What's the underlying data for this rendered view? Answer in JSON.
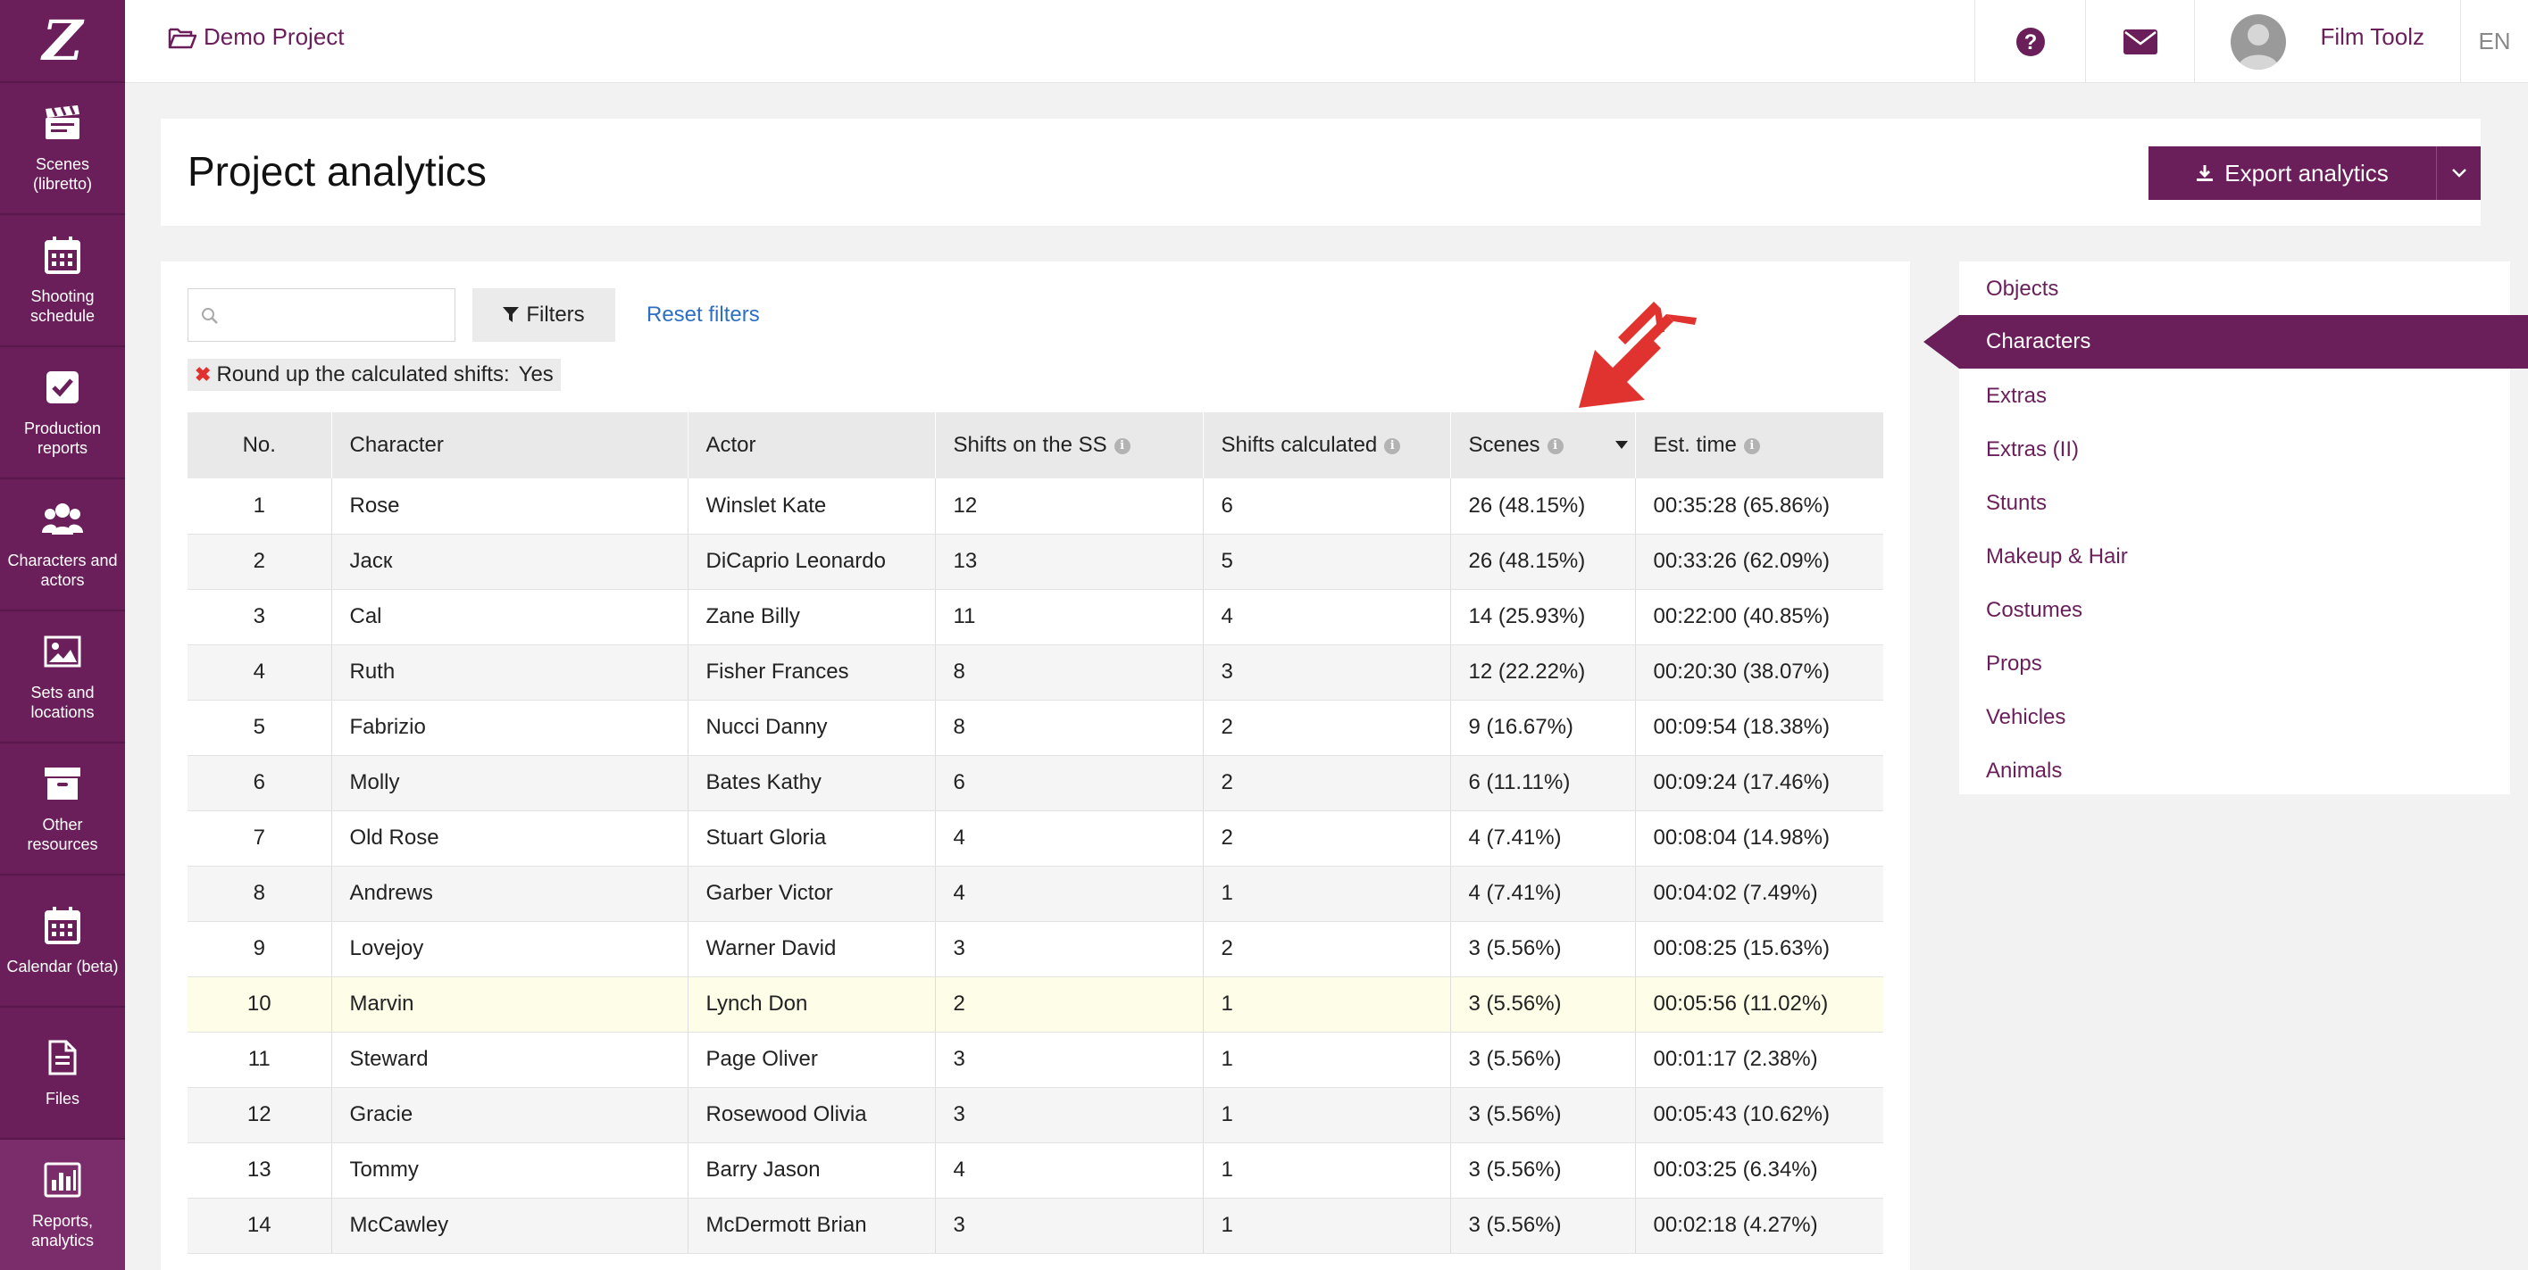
{
  "sidebar": {
    "logo": "Z",
    "items": [
      {
        "label": "Scenes (libretto)",
        "icon": "clapperboard-icon"
      },
      {
        "label": "Shooting schedule",
        "icon": "calendar-icon"
      },
      {
        "label": "Production reports",
        "icon": "checkbox-icon"
      },
      {
        "label": "Characters and actors",
        "icon": "users-icon"
      },
      {
        "label": "Sets and locations",
        "icon": "image-icon"
      },
      {
        "label": "Other resources",
        "icon": "archive-icon"
      },
      {
        "label": "Calendar (beta)",
        "icon": "calendar-icon"
      },
      {
        "label": "Files",
        "icon": "file-icon"
      },
      {
        "label": "Reports, analytics",
        "icon": "bar-chart-icon"
      }
    ]
  },
  "topbar": {
    "project": "Demo Project",
    "user": "Film Toolz",
    "lang": "EN"
  },
  "header": {
    "title": "Project analytics",
    "export": "Export analytics"
  },
  "filters": {
    "search_placeholder": "",
    "filters_label": "Filters",
    "reset_label": "Reset filters",
    "chip_label": "Round up the calculated shifts:",
    "chip_value": "Yes"
  },
  "table": {
    "columns": [
      "No.",
      "Character",
      "Actor",
      "Shifts on the SS",
      "Shifts calculated",
      "Scenes",
      "Est. time"
    ],
    "rows": [
      [
        "1",
        "Rose",
        "Winslet Kate",
        "12",
        "6",
        "26 (48.15%)",
        "00:35:28 (65.86%)"
      ],
      [
        "2",
        "Jacк",
        "DiCaprio Leonardo",
        "13",
        "5",
        "26 (48.15%)",
        "00:33:26 (62.09%)"
      ],
      [
        "3",
        "Cal",
        "Zane Billy",
        "11",
        "4",
        "14 (25.93%)",
        "00:22:00 (40.85%)"
      ],
      [
        "4",
        "Ruth",
        "Fisher Frances",
        "8",
        "3",
        "12 (22.22%)",
        "00:20:30 (38.07%)"
      ],
      [
        "5",
        "Fabrizio",
        "Nucci Danny",
        "8",
        "2",
        "9 (16.67%)",
        "00:09:54 (18.38%)"
      ],
      [
        "6",
        "Molly",
        "Bates Kathy",
        "6",
        "2",
        "6 (11.11%)",
        "00:09:24 (17.46%)"
      ],
      [
        "7",
        "Old Rose",
        "Stuart Gloria",
        "4",
        "2",
        "4 (7.41%)",
        "00:08:04 (14.98%)"
      ],
      [
        "8",
        "Andrews",
        "Garber Victor",
        "4",
        "1",
        "4 (7.41%)",
        "00:04:02 (7.49%)"
      ],
      [
        "9",
        "Lovejoy",
        "Warner David",
        "3",
        "2",
        "3 (5.56%)",
        "00:08:25 (15.63%)"
      ],
      [
        "10",
        "Marvin",
        "Lynch Don",
        "2",
        "1",
        "3 (5.56%)",
        "00:05:56 (11.02%)"
      ],
      [
        "11",
        "Steward",
        "Page Oliver",
        "3",
        "1",
        "3 (5.56%)",
        "00:01:17 (2.38%)"
      ],
      [
        "12",
        "Gracie",
        "Rosewood Olivia",
        "3",
        "1",
        "3 (5.56%)",
        "00:05:43 (10.62%)"
      ],
      [
        "13",
        "Tommy",
        "Barry Jason",
        "4",
        "1",
        "3 (5.56%)",
        "00:03:25 (6.34%)"
      ],
      [
        "14",
        "McCawley",
        "McDermott Brian",
        "3",
        "1",
        "3 (5.56%)",
        "00:02:18 (4.27%)"
      ]
    ]
  },
  "resources": {
    "items": [
      "Objects",
      "Characters",
      "Extras",
      "Extras (II)",
      "Stunts",
      "Makeup & Hair",
      "Costumes",
      "Props",
      "Vehicles",
      "Animals"
    ],
    "active": "Characters"
  },
  "colors": {
    "brand": "#6a1f5a",
    "link": "#2d6fc4",
    "annotation_arrow": "#e0322e"
  }
}
